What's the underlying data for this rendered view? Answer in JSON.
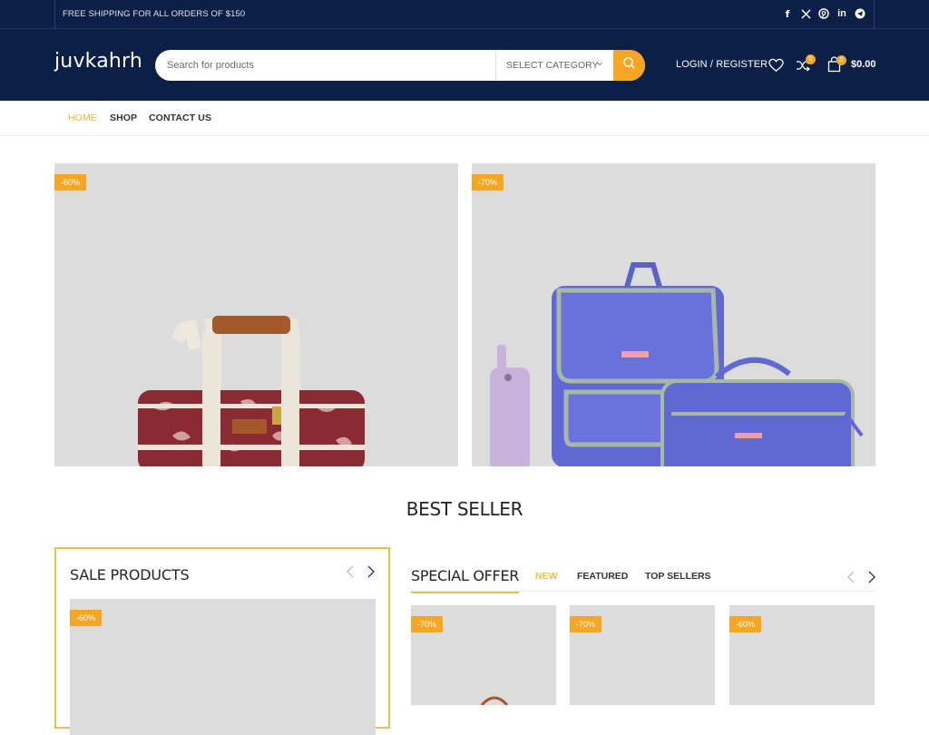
{
  "topbar": {
    "shipping_text": "FREE SHIPPING FOR ALL ORDERS OF $150",
    "socials": [
      {
        "name": "facebook-icon",
        "glyph": "f"
      },
      {
        "name": "x-twitter-icon",
        "glyph": "𝕏"
      },
      {
        "name": "pinterest-icon",
        "glyph": "P"
      },
      {
        "name": "linkedin-icon",
        "glyph": "in"
      },
      {
        "name": "telegram-icon",
        "glyph": "➤"
      }
    ]
  },
  "header": {
    "logo": "juvkahrh",
    "search": {
      "placeholder": "Search for products",
      "value": "",
      "category_label": "SELECT CATEGORY"
    },
    "login_label": "LOGIN / REGISTER",
    "compare_count": "0",
    "cart_count": "0",
    "cart_total": "$0.00"
  },
  "nav": {
    "items": [
      {
        "label": "HOME",
        "active": true
      },
      {
        "label": "SHOP",
        "active": false
      },
      {
        "label": "CONTACT US",
        "active": false
      }
    ]
  },
  "banners": [
    {
      "discount": "-60%",
      "product": "floral cooler bag"
    },
    {
      "discount": "-70%",
      "product": "purple backpack and lunch bag set"
    }
  ],
  "best_seller": {
    "title": "BEST SELLER"
  },
  "sale_products": {
    "title": "SALE PRODUCTS",
    "items": [
      {
        "discount": "-60%"
      }
    ]
  },
  "special_offer": {
    "title": "SPECIAL OFFER",
    "tabs": [
      {
        "label": "NEW",
        "active": true
      },
      {
        "label": "FEATURED",
        "active": false
      },
      {
        "label": "TOP SELLERS",
        "active": false
      }
    ],
    "products": [
      {
        "discount": "-70%"
      },
      {
        "discount": "-70%"
      },
      {
        "discount": "-60%"
      }
    ]
  },
  "colors": {
    "header_bg": "#0b1f47",
    "accent": "#f5a623",
    "active_nav": "#f0b43a",
    "box_border": "#e7c14f",
    "image_placeholder": "#dcdcdc"
  }
}
